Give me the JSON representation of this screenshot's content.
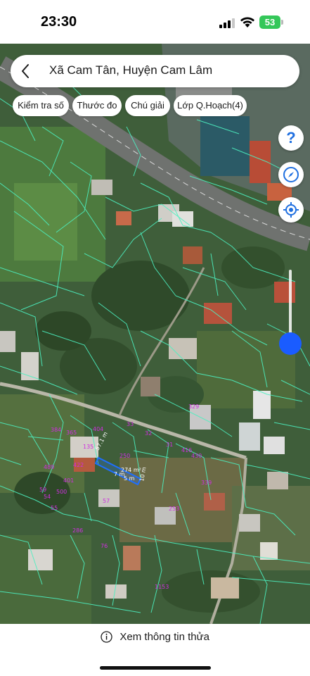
{
  "status_bar": {
    "time": "23:30",
    "battery_level": "53",
    "icons": [
      "cellular-signal-icon",
      "wifi-icon",
      "battery-icon"
    ]
  },
  "search": {
    "location": "Xã Cam Tân, Huyện Cam Lâm"
  },
  "toolbar": {
    "chips": [
      "Kiểm tra số",
      "Thước đo",
      "Chú giải",
      "Lớp Q.Hoạch(4)"
    ]
  },
  "map_controls": {
    "help_label": "?",
    "icons": [
      "help-icon",
      "compass-icon",
      "my-location-icon"
    ],
    "opacity_slider_level": 0.1
  },
  "map": {
    "parcel_numbers": [
      "329",
      "33",
      "32",
      "31",
      "416",
      "430",
      "250",
      "404",
      "384",
      "365",
      "135",
      "489",
      "422",
      "401",
      "500",
      "59",
      "54",
      "55",
      "57",
      "253",
      "286",
      "76",
      "339",
      "1153"
    ],
    "selected_parcel": {
      "area": "274 m²",
      "dimensions": [
        "57.1 m",
        "5 m",
        "10 m",
        "7 m"
      ]
    }
  },
  "bottom_panel": {
    "info_label": "Xem thông tin thửa"
  },
  "colors": {
    "accent": "#1a5cff",
    "parcel_lines": "#4cf0c0",
    "plot_numbers": "#d02ee0",
    "selected_parcel": "#1e6fff"
  }
}
